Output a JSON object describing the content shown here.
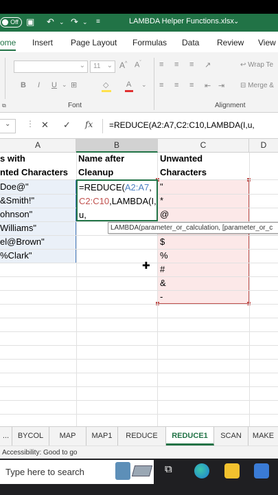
{
  "titlebar": {
    "autosave": "Off",
    "title": "LAMBDA Helper Functions.xlsx"
  },
  "ribbon_tabs": [
    "ome",
    "Insert",
    "Page Layout",
    "Formulas",
    "Data",
    "Review",
    "View"
  ],
  "ribbon": {
    "font_size": "11",
    "font_group_label": "Font",
    "alignment_group_label": "Alignment",
    "wrap_text": "Wrap Te",
    "merge": "Merge &"
  },
  "formula_bar": {
    "formula": "=REDUCE(A2:A7,C2:C10,LAMBDA(I,u,"
  },
  "columns": [
    "A",
    "B",
    "C",
    "D"
  ],
  "colA": {
    "header1": "s with",
    "header2": "nted Characters",
    "values": [
      "Doe@\"",
      "&Smith!\"",
      "ohnson\"",
      "Williams\"",
      "el@Brown\"",
      "%Clark\""
    ]
  },
  "colB": {
    "header1": "Name after",
    "header2": "Cleanup",
    "edit_line1_a": "=REDUCE(",
    "edit_line1_b": "A2:A7",
    "edit_line1_c": ",",
    "edit_line2_a": "C2:C10",
    "edit_line2_b": ",LAMBDA(I,",
    "edit_line3": "u,"
  },
  "colC": {
    "header1": "Unwanted",
    "header2": "Characters",
    "values": [
      "\"",
      "*",
      "@",
      "",
      "$",
      "%",
      "#",
      "&",
      "-"
    ]
  },
  "tooltip": "LAMBDA(parameter_or_calculation, [parameter_or_c",
  "sheet_tabs": [
    "...",
    "BYCOL",
    "MAP",
    "MAP1",
    "REDUCE",
    "REDUCE1",
    "SCAN",
    "MAKE"
  ],
  "status": "Accessibility: Good to go",
  "taskbar": {
    "search_placeholder": "Type here to search"
  },
  "colors": {
    "excel_green": "#217346",
    "range_a": "#4a7ec0",
    "range_c": "#c0504d"
  }
}
